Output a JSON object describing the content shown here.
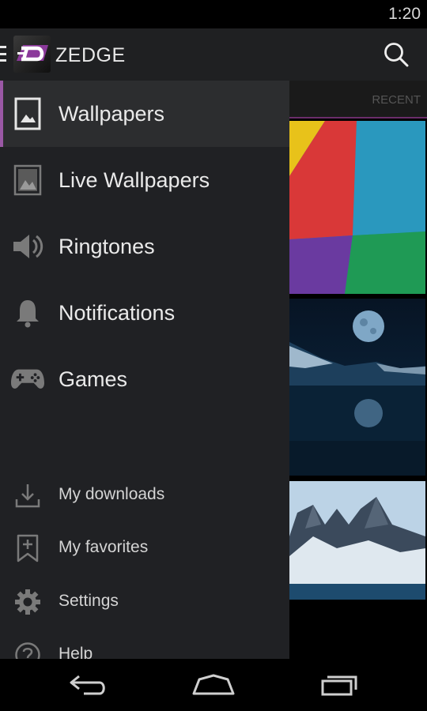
{
  "status_bar": {
    "time": "1:20"
  },
  "action_bar": {
    "title": "ZEDGE"
  },
  "content": {
    "tab_label": "RECENT"
  },
  "drawer": {
    "primary_items": [
      {
        "label": "Wallpapers",
        "icon": "wallpaper-icon",
        "selected": true
      },
      {
        "label": "Live Wallpapers",
        "icon": "live-wallpaper-icon"
      },
      {
        "label": "Ringtones",
        "icon": "speaker-icon"
      },
      {
        "label": "Notifications",
        "icon": "bell-icon"
      },
      {
        "label": "Games",
        "icon": "gamepad-icon"
      }
    ],
    "secondary_items": [
      {
        "label": "My downloads",
        "icon": "download-icon"
      },
      {
        "label": "My favorites",
        "icon": "bookmark-add-icon"
      },
      {
        "label": "Settings",
        "icon": "gear-icon"
      },
      {
        "label": "Help",
        "icon": "help-icon"
      }
    ]
  },
  "colors": {
    "accent": "#9a58a5",
    "drawer_bg": "#202124",
    "selected_bg": "#2c2d2f",
    "action_bar_bg": "#1f2022"
  }
}
